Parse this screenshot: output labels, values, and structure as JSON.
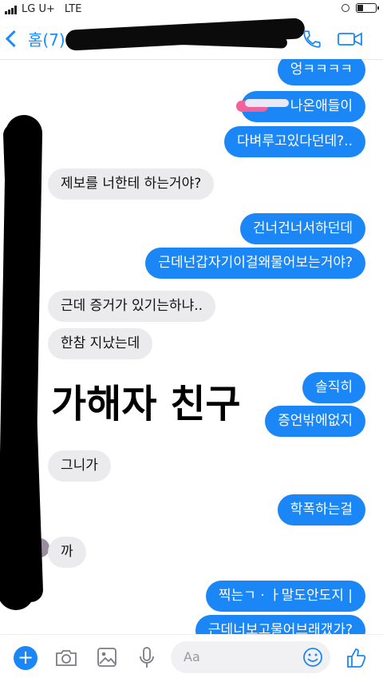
{
  "status_bar": {
    "carrier": "LG U+",
    "network": "LTE"
  },
  "header": {
    "back_label": "홈(7)",
    "icons": [
      "back-chevron-icon",
      "phone-icon",
      "video-icon"
    ]
  },
  "messages": [
    {
      "dir": "out",
      "text": "엉ㅋㅋㅋㅋ"
    },
    {
      "dir": "out",
      "text": "나온애들이"
    },
    {
      "dir": "out",
      "text": "다벼루고있다던데?.."
    },
    {
      "dir": "in",
      "text": "제보를 너한테 하는거야?"
    },
    {
      "dir": "out",
      "text": "건너건너서하던데"
    },
    {
      "dir": "out",
      "text": "근데넌갑자기이걸왜물어보는거야?"
    },
    {
      "dir": "in",
      "text": "근데 증거가 있기는하냐.."
    },
    {
      "dir": "in",
      "text": "한참 지났는데"
    },
    {
      "dir": "out",
      "text": "솔직히"
    },
    {
      "dir": "out",
      "text": "증언밖에없지"
    },
    {
      "dir": "in",
      "text": "그니가"
    },
    {
      "dir": "out",
      "text": "학폭하는걸"
    },
    {
      "dir": "in",
      "text": "까"
    },
    {
      "dir": "out",
      "text": "찍는ㄱ ·  ㅏ말도안도지 |"
    },
    {
      "dir": "out",
      "text": "근데너보고물어브래갰가?"
    }
  ],
  "overlay": {
    "caption": "가해자 친구"
  },
  "composer": {
    "placeholder": "Aa",
    "icons": [
      "plus-icon",
      "camera-icon",
      "image-icon",
      "microphone-icon",
      "emoji-icon",
      "thumbs-up-icon"
    ]
  },
  "colors": {
    "accent": "#1b86f5",
    "incoming_bubble": "#ebebed",
    "redaction": "#000000",
    "highlight": "#f2629a"
  }
}
